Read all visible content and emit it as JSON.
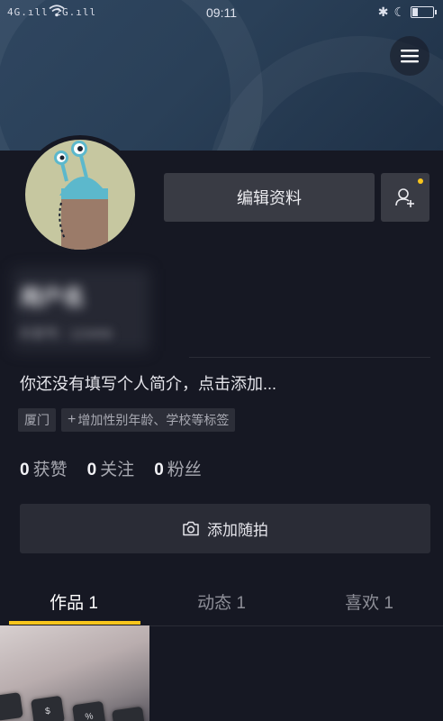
{
  "status_bar": {
    "signal_text": "4G.ıll 2G.ıll",
    "time": "09:11",
    "icons": [
      "signal-icon",
      "wifi-icon",
      "bluetooth-icon",
      "moon-icon",
      "battery-icon"
    ]
  },
  "header": {
    "menu_icon": "menu-icon"
  },
  "profile": {
    "edit_label": "编辑资料",
    "add_friend_icon": "add-friend-icon",
    "nickname": "用户名",
    "user_id": "抖音号：123456",
    "bio": "你还没有填写个人简介，点击添加...",
    "tags": [
      {
        "label": "厦门"
      },
      {
        "label": "增加性别年龄、学校等标签",
        "prefix": "+"
      }
    ]
  },
  "stats": [
    {
      "value": "0",
      "label": "获赞"
    },
    {
      "value": "0",
      "label": "关注"
    },
    {
      "value": "0",
      "label": "粉丝"
    }
  ],
  "story": {
    "label": "添加随拍",
    "icon": "camera-icon"
  },
  "tabs": [
    {
      "label": "作品 1",
      "active": true
    },
    {
      "label": "动态 1",
      "active": false
    },
    {
      "label": "喜欢 1",
      "active": false
    }
  ],
  "thumb_keys": [
    "$",
    "%"
  ],
  "colors": {
    "background": "#161823",
    "accent": "#f8c51c",
    "button": "#393b44"
  }
}
